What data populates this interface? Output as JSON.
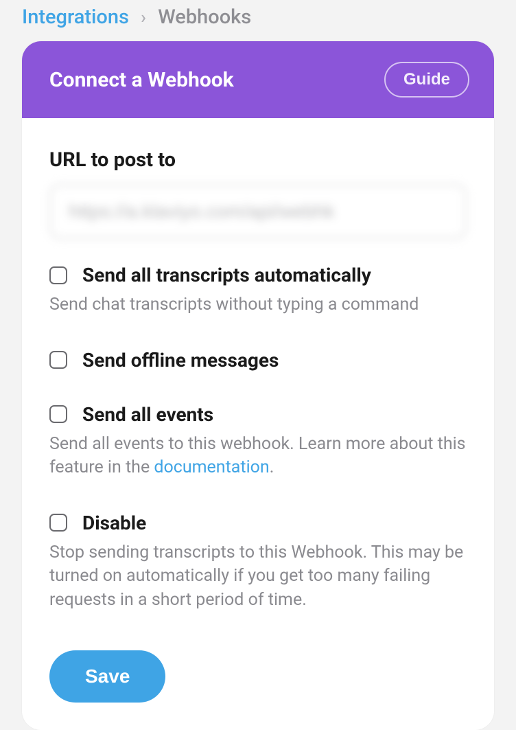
{
  "breadcrumb": {
    "link": "Integrations",
    "current": "Webhooks"
  },
  "card": {
    "title": "Connect a Webhook",
    "guide_label": "Guide"
  },
  "form": {
    "url_label": "URL to post to",
    "url_value": "https://a.klaviyo.com/api/webhk",
    "options": [
      {
        "title": "Send all transcripts automatically",
        "desc_pre": "Send chat transcripts without typing a command",
        "doclink": "",
        "desc_post": ""
      },
      {
        "title": "Send offline messages",
        "desc_pre": "",
        "doclink": "",
        "desc_post": ""
      },
      {
        "title": "Send all events",
        "desc_pre": "Send all events to this webhook. Learn more about this feature in the ",
        "doclink": "documentation",
        "desc_post": "."
      },
      {
        "title": "Disable",
        "desc_pre": "Stop sending transcripts to this Webhook. This may be turned on automatically if you get too many failing requests in a short period of time.",
        "doclink": "",
        "desc_post": ""
      }
    ],
    "save_label": "Save"
  }
}
